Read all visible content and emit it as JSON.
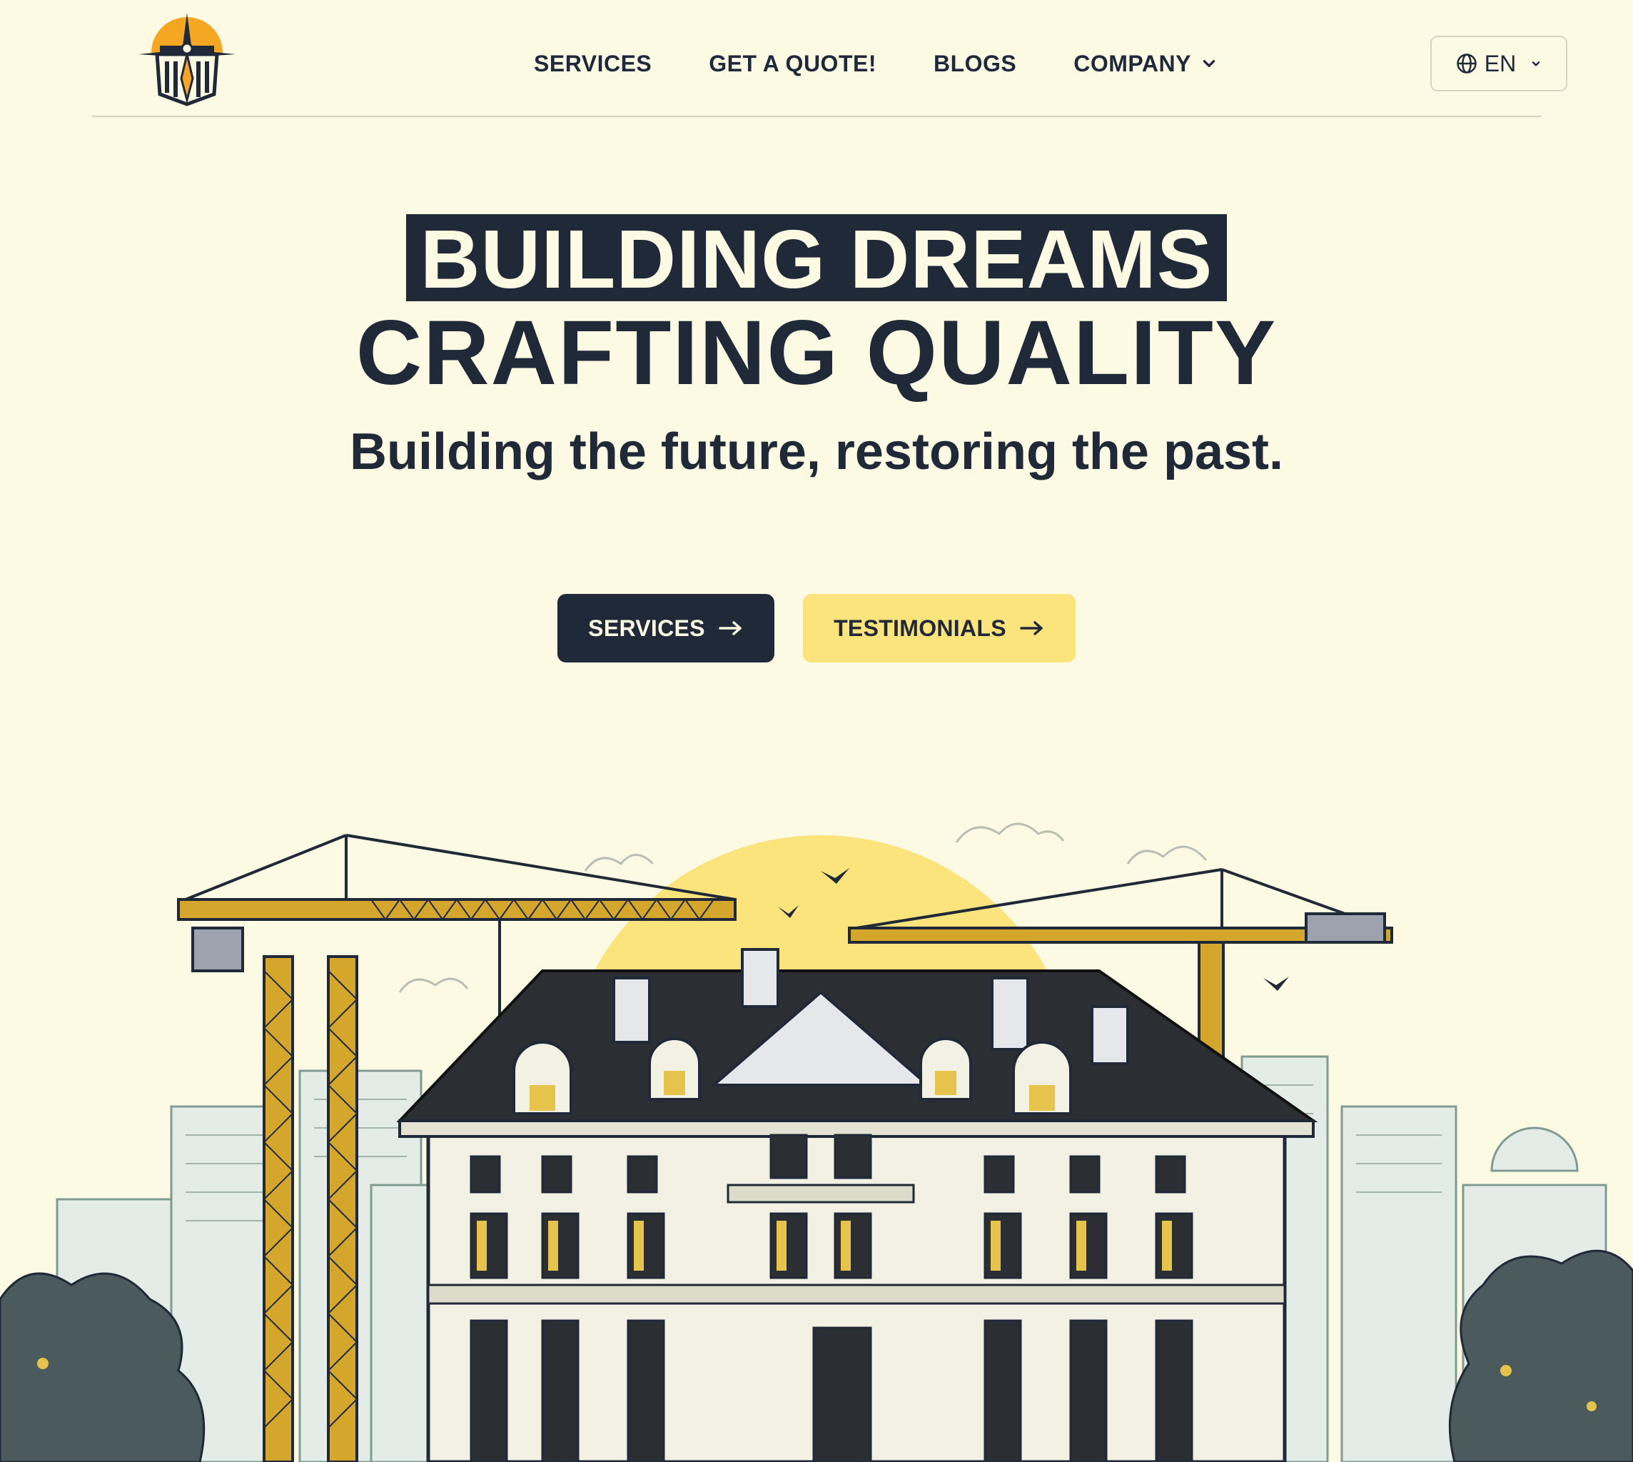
{
  "nav": {
    "items": [
      {
        "label": "SERVICES"
      },
      {
        "label": "GET A QUOTE!"
      },
      {
        "label": "BLOGS"
      },
      {
        "label": "COMPANY",
        "has_dropdown": true
      }
    ]
  },
  "language": {
    "current": "EN",
    "icon": "globe-icon"
  },
  "hero": {
    "title_line_1": "BUILDING DREAMS",
    "title_line_2": "CRAFTING QUALITY",
    "subtitle": "Building the future, restoring the past."
  },
  "cta": {
    "primary_label": "SERVICES",
    "secondary_label": "TESTIMONIALS"
  },
  "colors": {
    "background": "#fdfae4",
    "dark": "#1f2937",
    "accent_yellow": "#fbe47c",
    "logo_orange": "#f5a623"
  }
}
